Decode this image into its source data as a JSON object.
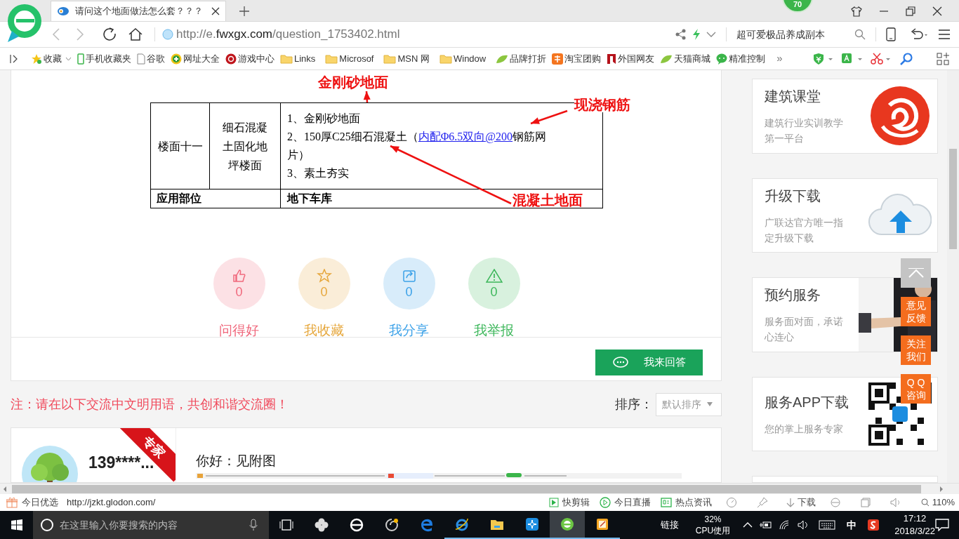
{
  "browser": {
    "tab_title": "请问这个地面做法怎么套？？？",
    "badge": "70",
    "url": {
      "prefix": "http://e.",
      "domain": "fwxgx.com",
      "path": "/question_1753402.html"
    },
    "search_text": "超可爱极品养成副本",
    "bookmarks": [
      {
        "kind": "star",
        "label": "收藏"
      },
      {
        "kind": "phone",
        "label": "手机收藏夹"
      },
      {
        "kind": "page",
        "label": "谷歌"
      },
      {
        "kind": "globe",
        "label": "网址大全"
      },
      {
        "kind": "game",
        "label": "游戏中心"
      },
      {
        "kind": "folder",
        "label": "Links"
      },
      {
        "kind": "folder",
        "label": "Microsof"
      },
      {
        "kind": "folder",
        "label": "MSN 网"
      },
      {
        "kind": "folder",
        "label": "Window"
      },
      {
        "kind": "leaf",
        "label": "品牌打折"
      },
      {
        "kind": "taobao",
        "label": "淘宝团购"
      },
      {
        "kind": "flag",
        "label": "外国网友"
      },
      {
        "kind": "leaf",
        "label": "天猫商城"
      },
      {
        "kind": "chat",
        "label": "精准控制"
      }
    ],
    "more": "»"
  },
  "question": {
    "annotations": [
      {
        "text": "金刚砂地面"
      },
      {
        "text": "现浇钢筋"
      },
      {
        "text": "混凝土地面"
      }
    ],
    "table": {
      "name_cell": "楼面十一",
      "type_cell": "细石混凝土固化地坪楼面",
      "steps": [
        {
          "text": "1、金刚砂地面"
        },
        {
          "before": "2、150厚C25细石混凝土（",
          "link": "内配Φ6.5双向@200",
          "after": "钢筋网片）"
        },
        {
          "text": "3、素土夯实"
        }
      ],
      "footer_label": "应用部位",
      "footer_value": "地下车库"
    },
    "actions": [
      {
        "kind": "like",
        "count": "0",
        "label": "问得好",
        "color": "#f0697d"
      },
      {
        "kind": "star",
        "count": "0",
        "label": "我收藏",
        "color": "#e6a73c"
      },
      {
        "kind": "share",
        "count": "0",
        "label": "我分享",
        "color": "#3ba1e8"
      },
      {
        "kind": "report",
        "count": "0",
        "label": "我举报",
        "color": "#3db75b"
      }
    ],
    "answer_button": "我来回答"
  },
  "notice": "注：请在以下交流中文明用语，共创和谐交流圈！",
  "sort": {
    "label": "排序：",
    "value": "默认排序"
  },
  "answer": {
    "user": "139****...",
    "badge": "专家",
    "text": "你好：见附图"
  },
  "sidebar": [
    {
      "kind": "logo",
      "title": "建筑课堂",
      "subtitle": "建筑行业实训教学第一平台"
    },
    {
      "kind": "cloud",
      "title": "升级下载",
      "subtitle": "广联达官方唯一指定升级下载"
    },
    {
      "kind": "picture",
      "title": "预约服务",
      "subtitle": "服务面对面，承诺心连心"
    },
    {
      "kind": "qr",
      "title": "服务APP下载",
      "subtitle": "您的掌上服务专家"
    }
  ],
  "float_buttons": [
    {
      "kind": "top"
    },
    {
      "kind": "text",
      "lines": [
        "意见",
        "反馈"
      ]
    },
    {
      "kind": "text",
      "lines": [
        "关注",
        "我们"
      ]
    },
    {
      "kind": "text",
      "lines": [
        "Q Q",
        "咨询"
      ]
    }
  ],
  "status_bar": {
    "left_label": "今日优选",
    "link": "http://jzkt.glodon.com/",
    "items": [
      {
        "kind": "clip",
        "label": "快剪辑"
      },
      {
        "kind": "live",
        "label": "今日直播"
      },
      {
        "kind": "news",
        "label": "热点资讯"
      }
    ],
    "download": "下载",
    "zoom": "110%"
  },
  "taskbar": {
    "search_placeholder": "在这里输入你要搜索的内容",
    "link_label": "链接",
    "cpu_value": "32%",
    "cpu_label": "CPU使用",
    "ime": "中",
    "time": "17:12",
    "date": "2018/3/22"
  }
}
